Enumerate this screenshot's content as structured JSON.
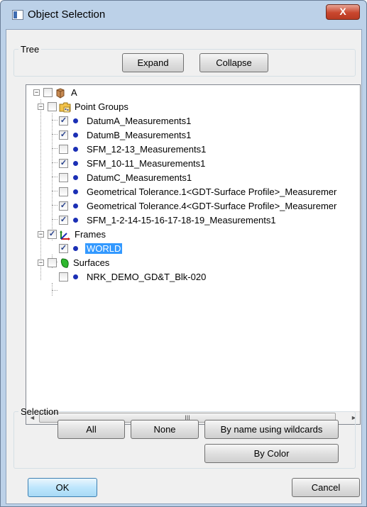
{
  "window": {
    "title": "Object Selection",
    "close_glyph": "X"
  },
  "tree_group": {
    "legend": "Tree",
    "expand_label": "Expand",
    "collapse_label": "Collapse"
  },
  "tree": {
    "root": {
      "label": "A",
      "expander": "−",
      "checked": false,
      "icon": "cube-icon"
    },
    "point_groups": {
      "label": "Point Groups",
      "expander": "−",
      "checked": false,
      "icon": "point-group-folder-icon",
      "items": [
        {
          "label": "DatumA_Measurements1",
          "checked": true
        },
        {
          "label": "DatumB_Measurements1",
          "checked": true
        },
        {
          "label": "SFM_12-13_Measurements1",
          "checked": false
        },
        {
          "label": "SFM_10-11_Measurements1",
          "checked": true
        },
        {
          "label": "DatumC_Measurements1",
          "checked": false
        },
        {
          "label": "Geometrical Tolerance.1<GDT-Surface Profile>_Measuremer",
          "checked": false
        },
        {
          "label": "Geometrical Tolerance.4<GDT-Surface Profile>_Measuremer",
          "checked": true
        },
        {
          "label": "SFM_1-2-14-15-16-17-18-19_Measurements1",
          "checked": true
        }
      ]
    },
    "frames": {
      "label": "Frames",
      "expander": "−",
      "checked": true,
      "icon": "frame-axes-icon",
      "items": [
        {
          "label": "WORLD",
          "checked": true,
          "selected": true
        }
      ]
    },
    "surfaces": {
      "label": "Surfaces",
      "expander": "−",
      "checked": false,
      "icon": "surface-icon",
      "items": [
        {
          "label": "NRK_DEMO_GD&T_Blk-020",
          "checked": false
        }
      ]
    },
    "scroll": {
      "left_arrow": "◄",
      "right_arrow": "►",
      "thumb_grip": "III"
    },
    "check_glyph": "✓"
  },
  "selection_group": {
    "legend": "Selection",
    "all_label": "All",
    "none_label": "None",
    "wildcards_label": "By name using wildcards",
    "color_label": "By Color"
  },
  "footer": {
    "ok_label": "OK",
    "cancel_label": "Cancel"
  },
  "colors": {
    "title_bar": "#bcd1e8",
    "selection": "#3399ff",
    "point_dot": "#1b2fb5"
  }
}
